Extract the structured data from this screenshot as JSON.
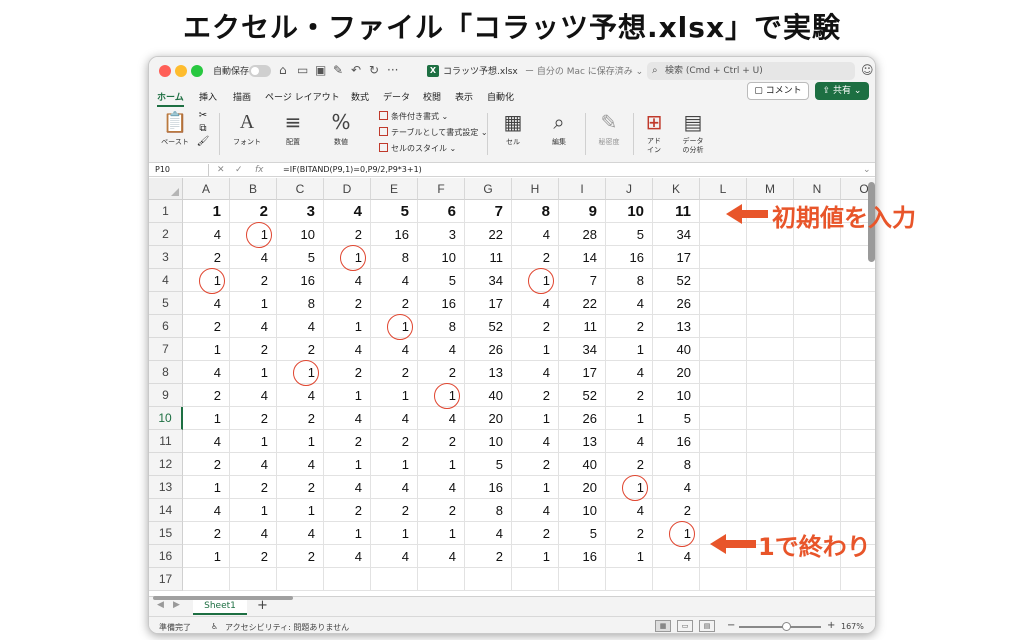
{
  "page_title": "エクセル・ファイル「コラッツ予想.xlsx」で実験",
  "titlebar": {
    "autosave_label": "自動保存",
    "file_name": "コラッツ予想.xlsx",
    "save_state": "ー 自分の Mac に保存済み ⌄",
    "search_placeholder": "検索 (Cmd + Ctrl + U)"
  },
  "tabs": [
    "ホーム",
    "挿入",
    "描画",
    "ページ レイアウト",
    "数式",
    "データ",
    "校閲",
    "表示",
    "自動化"
  ],
  "comment_label": "コメント",
  "share_label": "共有",
  "ribbon": {
    "paste": "ペースト",
    "font": "フォント",
    "align": "配置",
    "number": "数値",
    "conditional_format": "条件付き書式 ⌄",
    "table_format": "テーブルとして書式設定 ⌄",
    "cell_style": "セルのスタイル ⌄",
    "cells": "セル",
    "edit": "編集",
    "sensitivity": "秘密度",
    "addins": "アド\nイン",
    "analyze": "データ\nの分析"
  },
  "formula_bar": {
    "name_box": "P10",
    "formula": "=IF(BITAND(P9,1)=0,P9/2,P9*3+1)"
  },
  "columns": [
    "A",
    "B",
    "C",
    "D",
    "E",
    "F",
    "G",
    "H",
    "I",
    "J",
    "K",
    "L",
    "M",
    "N",
    "O"
  ],
  "rows": [
    [
      1,
      2,
      3,
      4,
      5,
      6,
      7,
      8,
      9,
      10,
      11
    ],
    [
      4,
      1,
      10,
      2,
      16,
      3,
      22,
      4,
      28,
      5,
      34
    ],
    [
      2,
      4,
      5,
      1,
      8,
      10,
      11,
      2,
      14,
      16,
      17
    ],
    [
      1,
      2,
      16,
      4,
      4,
      5,
      34,
      1,
      7,
      8,
      52
    ],
    [
      4,
      1,
      8,
      2,
      2,
      16,
      17,
      4,
      22,
      4,
      26
    ],
    [
      2,
      4,
      4,
      1,
      1,
      8,
      52,
      2,
      11,
      2,
      13
    ],
    [
      1,
      2,
      2,
      4,
      4,
      4,
      26,
      1,
      34,
      1,
      40
    ],
    [
      4,
      1,
      1,
      2,
      2,
      2,
      13,
      4,
      17,
      4,
      20
    ],
    [
      2,
      4,
      4,
      1,
      1,
      1,
      40,
      2,
      52,
      2,
      10
    ],
    [
      1,
      2,
      2,
      4,
      4,
      4,
      20,
      1,
      26,
      1,
      5
    ],
    [
      4,
      1,
      1,
      2,
      2,
      2,
      10,
      4,
      13,
      4,
      16
    ],
    [
      2,
      4,
      4,
      1,
      1,
      1,
      5,
      2,
      40,
      2,
      8
    ],
    [
      1,
      2,
      2,
      4,
      4,
      4,
      16,
      1,
      20,
      1,
      4
    ],
    [
      4,
      1,
      1,
      2,
      2,
      2,
      8,
      4,
      10,
      4,
      2
    ],
    [
      2,
      4,
      4,
      1,
      1,
      1,
      4,
      2,
      5,
      2,
      1
    ],
    [
      1,
      2,
      2,
      4,
      4,
      4,
      2,
      1,
      16,
      1,
      4
    ]
  ],
  "circled_cells": [
    [
      2,
      1
    ],
    [
      3,
      3
    ],
    [
      4,
      0
    ],
    [
      4,
      7
    ],
    [
      6,
      4
    ],
    [
      8,
      2
    ],
    [
      9,
      5
    ],
    [
      13,
      9
    ],
    [
      15,
      10
    ]
  ],
  "sheet_tab": "Sheet1",
  "status": {
    "ready": "準備完了",
    "accessibility": "アクセシビリティ: 問題ありません",
    "zoom": "167%"
  },
  "annotations": {
    "initial": "初期値を入力",
    "end": "1で終わり"
  },
  "colors": {
    "accent": "#1d6f42",
    "annotation": "#e8552a",
    "circle": "#e0452f"
  }
}
